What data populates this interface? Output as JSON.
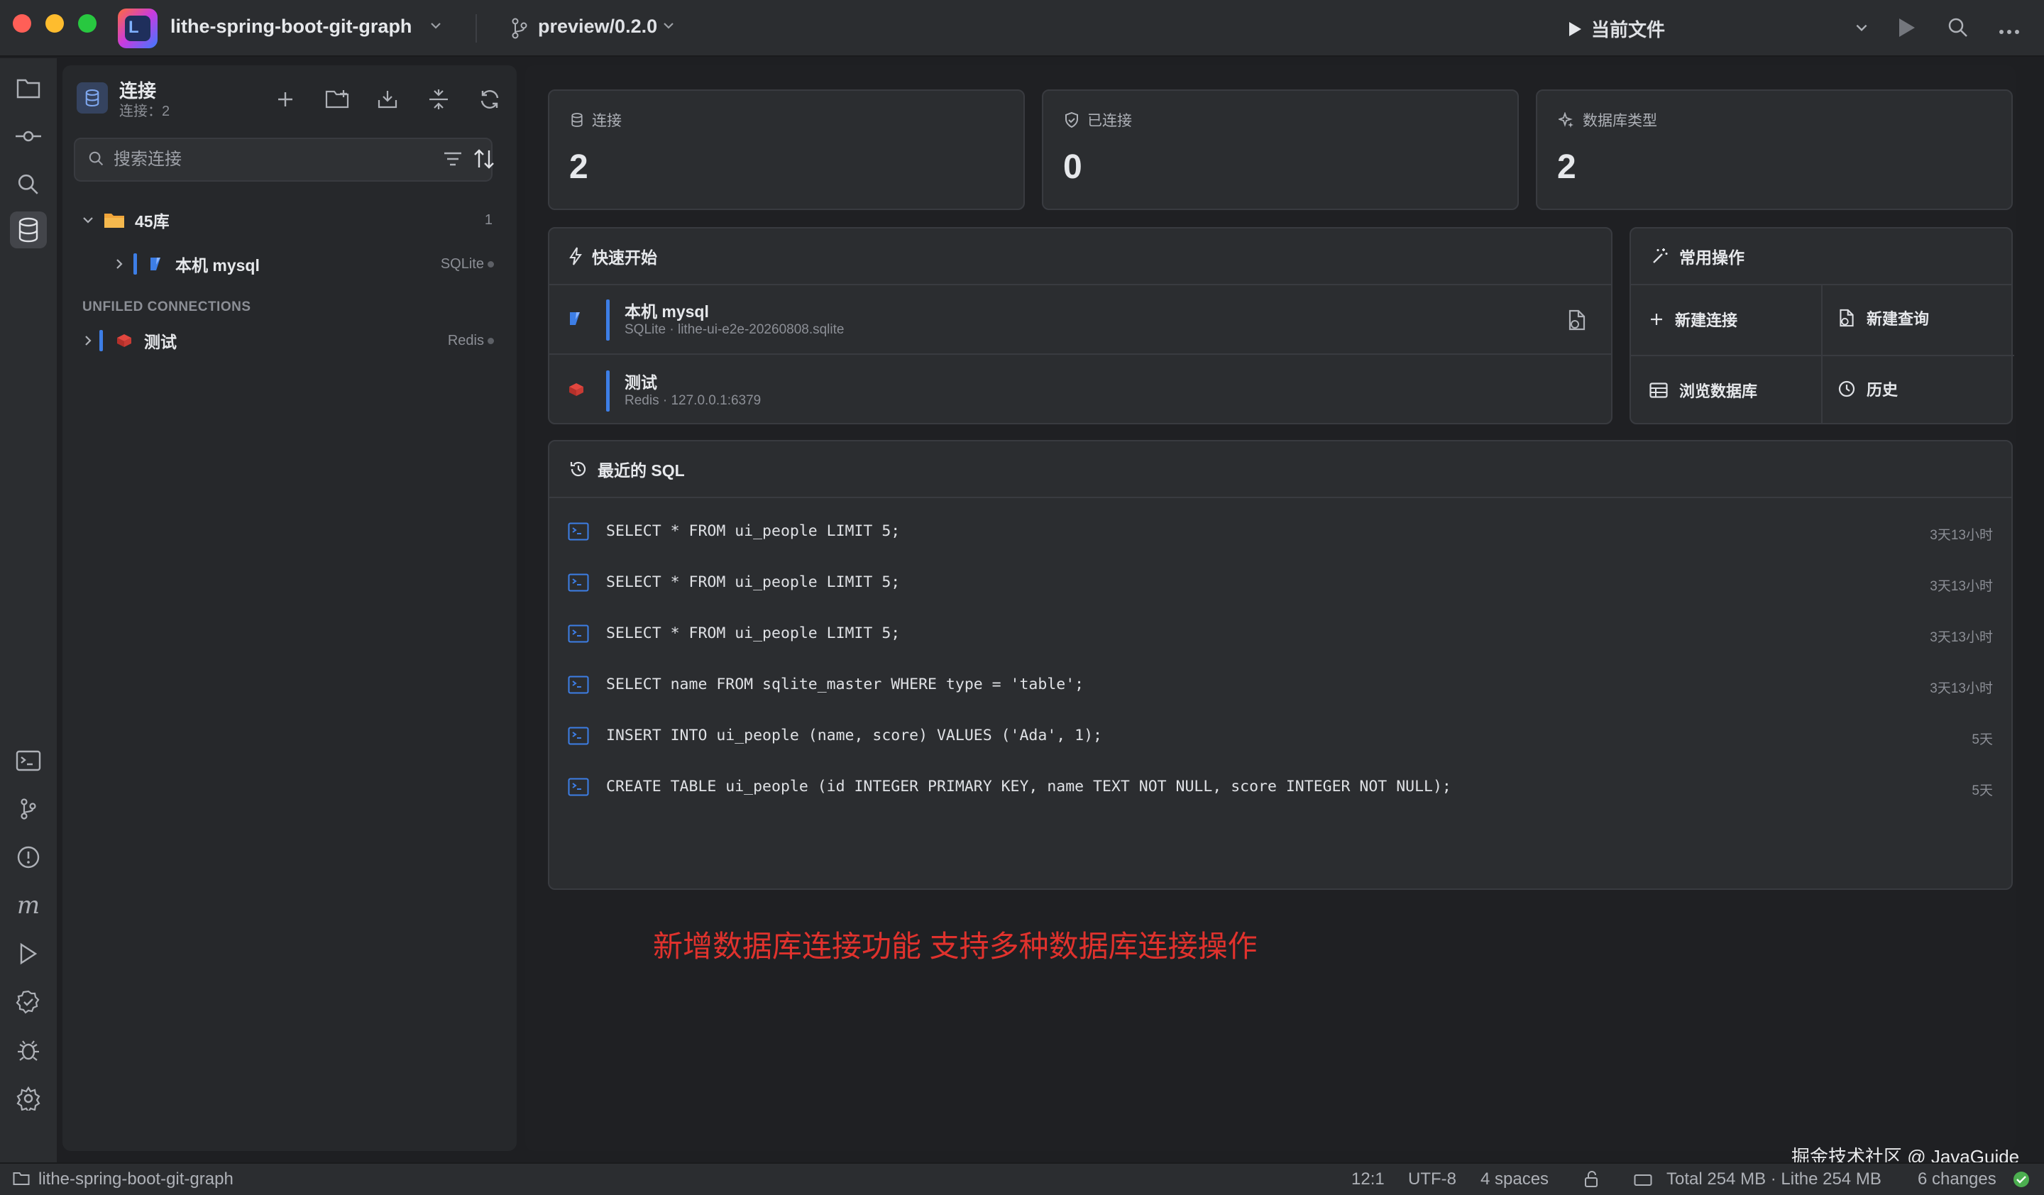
{
  "titlebar": {
    "project": "lithe-spring-boot-git-graph",
    "branch": "preview/0.2.0",
    "run_config": "当前文件"
  },
  "panel": {
    "title": "连接",
    "subtitle": "连接：2",
    "search_placeholder": "搜索连接",
    "folder": {
      "name": "45库",
      "count": "1"
    },
    "folder_items": [
      {
        "name": "本机 mysql",
        "type": "SQLite"
      }
    ],
    "unfiled_label": "UNFILED CONNECTIONS",
    "unfiled_items": [
      {
        "name": "测试",
        "type": "Redis"
      }
    ]
  },
  "stats": [
    {
      "label": "连接",
      "value": "2",
      "icon": "database-icon"
    },
    {
      "label": "已连接",
      "value": "0",
      "icon": "shield-check-icon"
    },
    {
      "label": "数据库类型",
      "value": "2",
      "icon": "sparkle-icon"
    }
  ],
  "quick_start": {
    "title": "快速开始",
    "items": [
      {
        "name": "本机 mysql",
        "desc": "SQLite · lithe-ui-e2e-20260808.sqlite"
      },
      {
        "name": "测试",
        "desc": "Redis · 127.0.0.1:6379"
      }
    ]
  },
  "common_ops": {
    "title": "常用操作",
    "new_connection": "新建连接",
    "new_query": "新建查询",
    "browse_db": "浏览数据库",
    "history": "历史"
  },
  "recent_sql": {
    "title": "最近的 SQL",
    "items": [
      {
        "sql": "SELECT * FROM ui_people LIMIT 5;",
        "time": "3天13小时"
      },
      {
        "sql": "SELECT * FROM ui_people LIMIT 5;",
        "time": "3天13小时"
      },
      {
        "sql": "SELECT * FROM ui_people LIMIT 5;",
        "time": "3天13小时"
      },
      {
        "sql": "SELECT name FROM sqlite_master WHERE type = 'table';",
        "time": "3天13小时"
      },
      {
        "sql": "INSERT INTO ui_people (name, score) VALUES ('Ada', 1);",
        "time": "5天"
      },
      {
        "sql": "CREATE TABLE ui_people (id INTEGER PRIMARY KEY, name TEXT NOT NULL, score INTEGER NOT NULL);",
        "time": "5天"
      }
    ]
  },
  "annotation": "新增数据库连接功能 支持多种数据库连接操作",
  "statusbar": {
    "project": "lithe-spring-boot-git-graph",
    "position": "12:1",
    "encoding": "UTF-8",
    "indent": "4 spaces",
    "memory": "Total 254 MB · Lithe 254 MB",
    "changes": "6 changes"
  },
  "watermark": "掘金技术社区 @ JavaGuide",
  "colors": {
    "accent": "#3d7ee6",
    "annotation": "#e0322d",
    "folder": "#f0a53a",
    "redis": "#d83b34"
  }
}
